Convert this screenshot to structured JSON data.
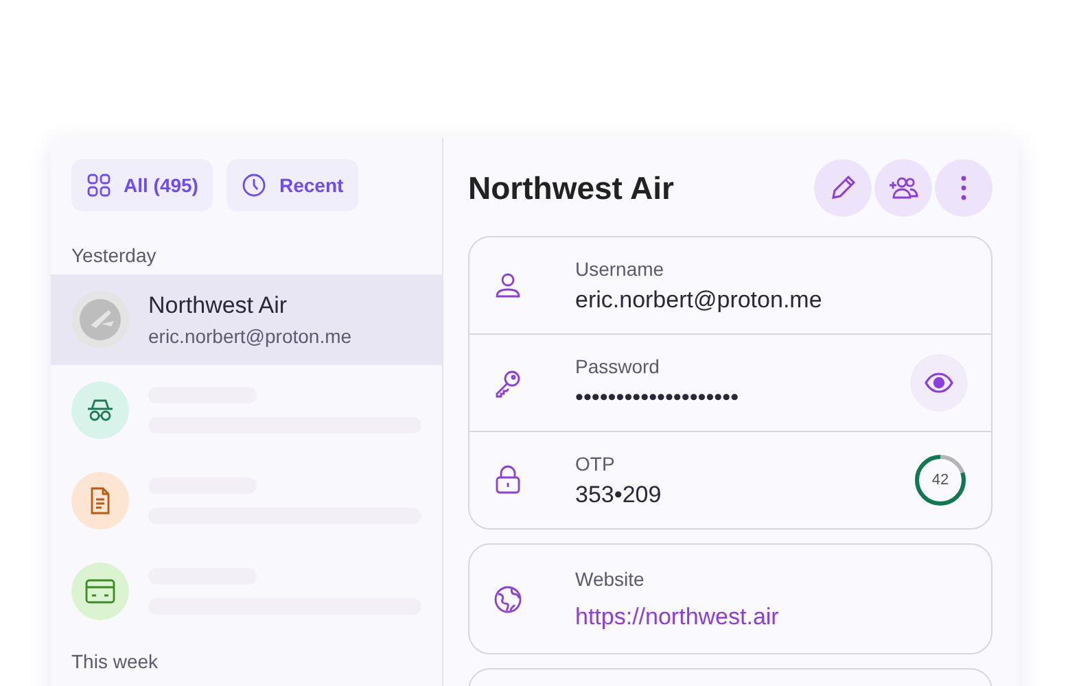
{
  "filters": [
    {
      "kind": "all",
      "label": "All (495)"
    },
    {
      "kind": "recent",
      "label": "Recent"
    }
  ],
  "sections": [
    {
      "title": "Yesterday",
      "items": [
        {
          "kind": "login",
          "title": "Northwest Air",
          "subtitle": "eric.norbert@proton.me",
          "selected": true
        },
        {
          "kind": "alias",
          "selected": false
        },
        {
          "kind": "note",
          "selected": false
        },
        {
          "kind": "card",
          "selected": false
        }
      ]
    },
    {
      "title": "This week"
    }
  ],
  "detail": {
    "title": "Northwest Air",
    "groups": [
      [
        {
          "kind": "username",
          "label": "Username",
          "value": "eric.norbert@proton.me"
        },
        {
          "kind": "password",
          "label": "Password",
          "value": "••••••••••••••••••••"
        },
        {
          "kind": "otp",
          "label": "OTP",
          "value": "353•209",
          "timer": "42",
          "level": 0.8
        }
      ],
      [
        {
          "kind": "website",
          "label": "Website",
          "value": "https://northwest.air"
        }
      ]
    ]
  }
}
